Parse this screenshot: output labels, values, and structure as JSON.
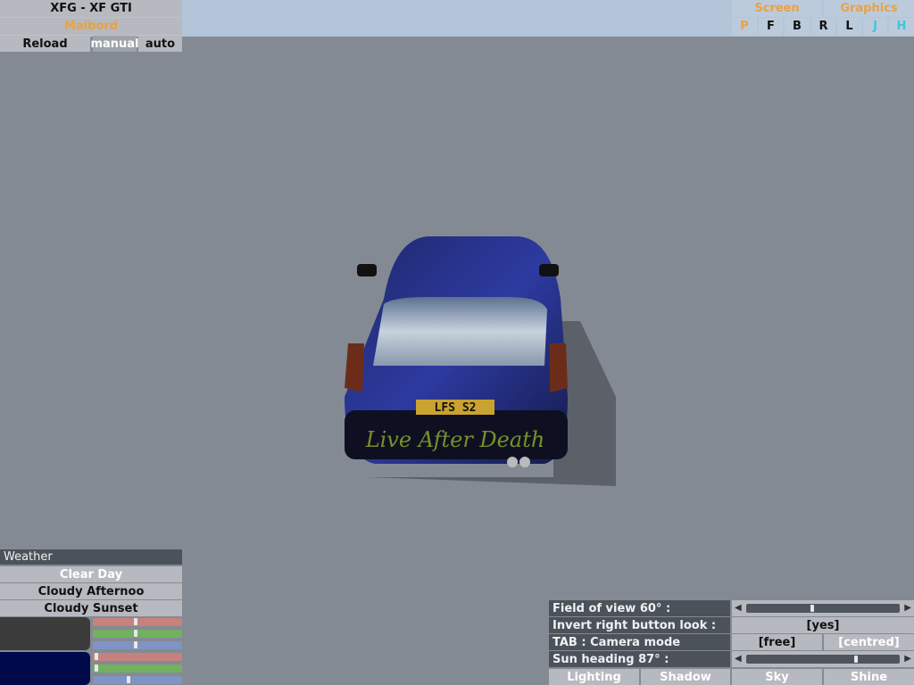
{
  "header": {
    "car_title": "XFG - XF GTI",
    "skin_name": "Malbord",
    "reload_label": "Reload",
    "manual_label": "manual",
    "auto_label": "auto"
  },
  "top_right": {
    "screen_label": "Screen",
    "graphics_label": "Graphics",
    "view_buttons": [
      "P",
      "F",
      "B",
      "R",
      "L",
      "J",
      "H"
    ]
  },
  "weather": {
    "title": "Weather",
    "options": [
      "Clear Day",
      "Cloudy Afternoo",
      "Cloudy Sunset"
    ],
    "colors": {
      "ambient": "#3b3b3b",
      "sky": "#000a4a"
    },
    "sliders": {
      "ambient": {
        "red": 0.48,
        "green": 0.48,
        "blue": 0.48
      },
      "sky": {
        "red": 0.02,
        "green": 0.02,
        "blue": 0.4
      }
    }
  },
  "camera": {
    "fov_label": "Field of view 60° :",
    "fov_value": 0.43,
    "invert_label": "Invert right button look :",
    "invert_value": "[yes]",
    "tab_label": "TAB : Camera mode",
    "mode_free": "[free]",
    "mode_centred": "[centred]",
    "sun_label": "Sun heading 87° :",
    "sun_value": 0.72,
    "left_arrow": "◀",
    "right_arrow": "▶"
  },
  "bottom_tabs": [
    "Lighting",
    "Shadow",
    "Sky",
    "Shine"
  ],
  "car": {
    "plate": "LFS S2",
    "bumper_text": "Live After Death"
  }
}
